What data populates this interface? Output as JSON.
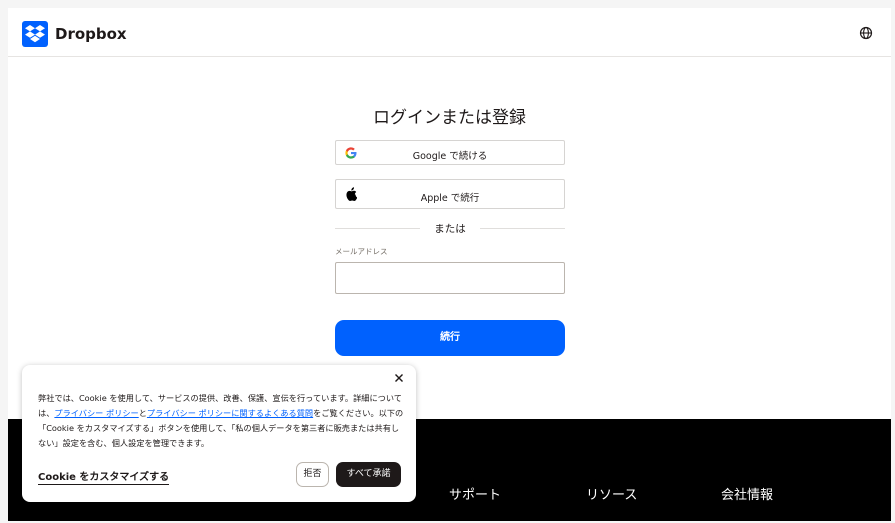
{
  "header": {
    "brand": "Dropbox",
    "brand_color": "#0061fe"
  },
  "login": {
    "title": "ログインまたは登録",
    "google_label": "Google で続ける",
    "apple_label": "Apple で続行",
    "or_text": "または",
    "email_label": "メールアドレス",
    "email_value": "",
    "continue_label": "続行"
  },
  "footer": {
    "links": [
      "サポート",
      "リソース",
      "会社情報"
    ]
  },
  "cookie": {
    "text_1": "弊社では、Cookie を使用して、サービスの提供、改善、保護、宣伝を行っています。詳細については、",
    "link_privacy": "プライバシー ポリシー",
    "text_and": "と",
    "link_faq": "プライバシー ポリシーに関するよくある質問",
    "text_2": "をご覧ください。以下の「Cookie をカスタマイズする」ボタンを使用して、「私の個人データを第三者に販売または共有しない」設定を含む、個人設定を管理できます。",
    "customize_label": "Cookie をカスタマイズする",
    "reject_label": "拒否",
    "accept_label": "すべて承諾"
  },
  "icons": {
    "brand_logo": "dropbox-logo-icon",
    "language": "globe-icon",
    "google": "google-icon",
    "apple": "apple-icon",
    "close": "close-icon"
  }
}
